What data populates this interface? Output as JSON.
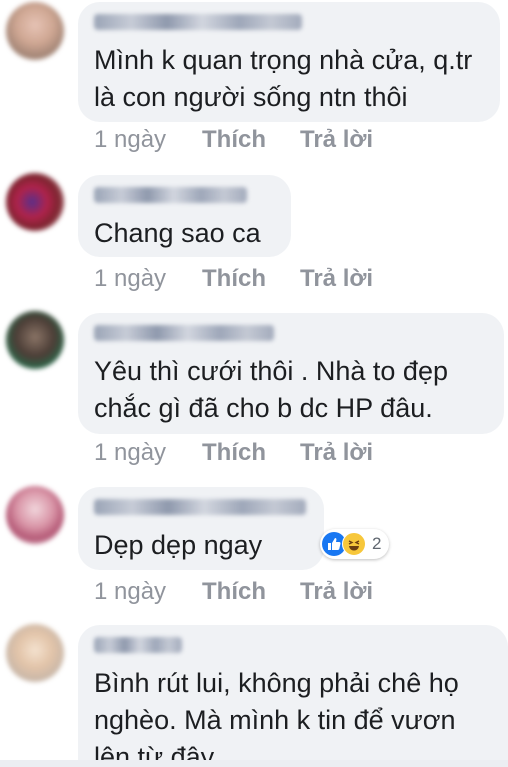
{
  "comments": [
    {
      "text": "Mình k quan trọng nhà cửa, q.tr\nlà con người sống ntn thôi",
      "time": "1 ngày",
      "like": "Thích",
      "reply": "Trả lời"
    },
    {
      "text": "Chang sao ca",
      "time": "1 ngày",
      "like": "Thích",
      "reply": "Trả lời"
    },
    {
      "text": "Yêu thì cưới thôi . Nhà to đẹp\nchắc gì đã cho b dc HP đâu.",
      "time": "1 ngày",
      "like": "Thích",
      "reply": "Trả lời"
    },
    {
      "text": "Dẹp dẹp ngay",
      "time": "1 ngày",
      "like": "Thích",
      "reply": "Trả lời",
      "reactions": {
        "count": "2",
        "types": [
          "like-icon",
          "haha-icon"
        ]
      }
    },
    {
      "text": "Bình rút lui, không phải chê họ\nnghèo. Mà mình k tin để vươn\nlên từ đây"
    }
  ],
  "colors": {
    "bubble": "#f0f2f5",
    "meta": "#90949c",
    "like_blue": "#1877f2",
    "haha_yellow": "#f7c73b"
  }
}
